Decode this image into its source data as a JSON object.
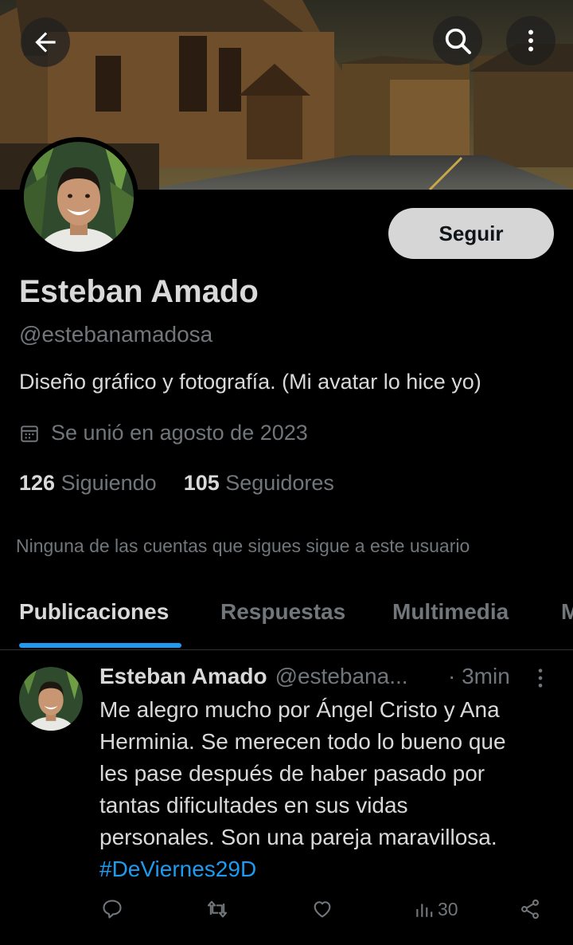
{
  "colors": {
    "background": "#000000",
    "accent": "#1d9bf0",
    "muted": "#71767b",
    "primary_text": "#d9d9d9",
    "follow_button_bg": "#d6d6d6"
  },
  "header": {
    "back_icon": "arrow-left-icon",
    "search_icon": "search-icon",
    "more_icon": "more-vertical-icon"
  },
  "profile": {
    "follow_label": "Seguir",
    "name": "Esteban Amado",
    "handle": "@estebanamadosa",
    "bio": "Diseño gráfico y fotografía. (Mi avatar lo hice yo)",
    "joined": "Se unió en agosto de 2023",
    "following_count": "126",
    "following_label": "Siguiendo",
    "followers_count": "105",
    "followers_label": "Seguidores",
    "mutual_note": "Ninguna de las cuentas que sigues sigue a este usuario"
  },
  "tabs": [
    {
      "label": "Publicaciones",
      "active": true
    },
    {
      "label": "Respuestas",
      "active": false
    },
    {
      "label": "Multimedia",
      "active": false
    },
    {
      "label": "M",
      "active": false
    }
  ],
  "post": {
    "author": "Esteban Amado",
    "handle": "@estebana...",
    "time": "· 3min",
    "text_lines": [
      "Me alegro mucho por Ángel Cristo y Ana",
      "Herminia. Se merecen todo lo bueno que",
      "les pase después de haber pasado por",
      "tantas dificultades en sus vidas",
      "personales. Son una pareja maravillosa."
    ],
    "hashtag": "#DeViernes29D",
    "views": "30"
  }
}
